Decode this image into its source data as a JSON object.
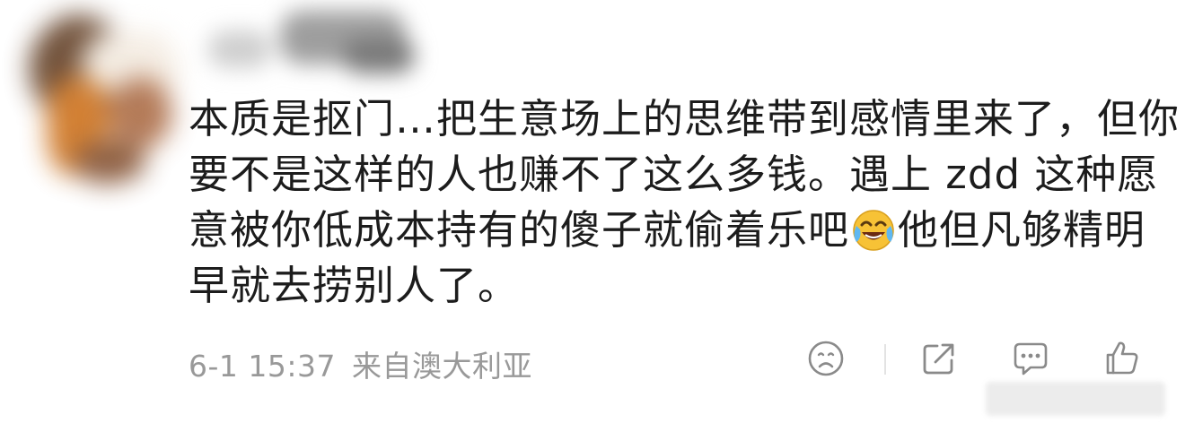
{
  "comment": {
    "lines": [
      "本质是抠门…把生意场上的思维带到感情里来了，但你",
      "要不是这样的人也赚不了这么多钱。遇上 zdd 这种愿",
      "意被你低成本持有的傻子就偷着乐吧",
      "他但凡够精明",
      "早就去捞别人了。"
    ],
    "emoji_name": "laughing-crying-emoji"
  },
  "meta": {
    "timestamp": "6-1 15:37",
    "location": "来自澳大利亚"
  },
  "icons": {
    "dislike": "sad-face-icon",
    "share": "share-icon",
    "reply": "comment-icon",
    "like": "thumbs-up-icon"
  },
  "colors": {
    "text": "#1c1c1c",
    "meta": "#999999",
    "icon": "#8a8a8a",
    "emoji_face": "#f7c236"
  }
}
